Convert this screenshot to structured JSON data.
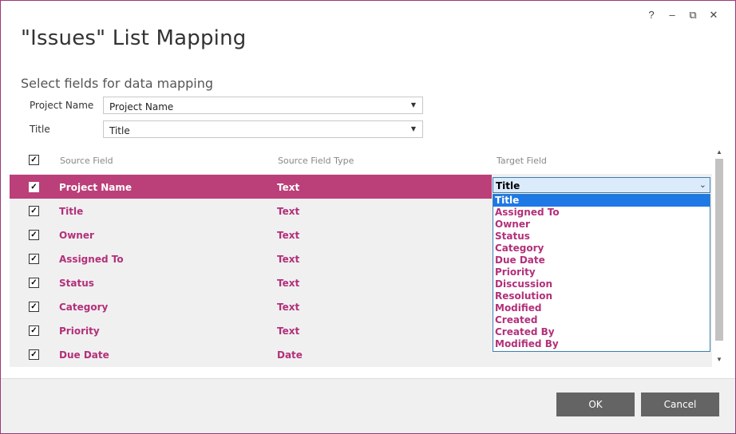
{
  "window_controls": {
    "help": "?",
    "minimize": "–",
    "restore": "⧉",
    "close": "✕"
  },
  "title": "\"Issues\" List Mapping",
  "subtitle": "Select fields for data mapping",
  "fields": [
    {
      "label": "Project Name",
      "value": "Project Name"
    },
    {
      "label": "Title",
      "value": "Title"
    }
  ],
  "grid": {
    "header": {
      "source_field": "Source Field",
      "source_field_type": "Source Field Type",
      "target_field": "Target Field",
      "all_checked": true
    },
    "rows": [
      {
        "source": "Project Name",
        "type": "Text",
        "checked": true,
        "selected": true
      },
      {
        "source": "Title",
        "type": "Text",
        "checked": true
      },
      {
        "source": "Owner",
        "type": "Text",
        "checked": true
      },
      {
        "source": "Assigned To",
        "type": "Text",
        "checked": true
      },
      {
        "source": "Status",
        "type": "Text",
        "checked": true
      },
      {
        "source": "Category",
        "type": "Text",
        "checked": true
      },
      {
        "source": "Priority",
        "type": "Text",
        "checked": true
      },
      {
        "source": "Due Date",
        "type": "Date",
        "checked": true
      }
    ]
  },
  "target_dropdown": {
    "value": "Title",
    "options": [
      "Title",
      "Assigned To",
      "Owner",
      "Status",
      "Category",
      "Due Date",
      "Priority",
      "Discussion",
      "Resolution",
      "Modified",
      "Created",
      "Created By",
      "Modified By"
    ],
    "highlighted": "Title"
  },
  "buttons": {
    "ok": "OK",
    "cancel": "Cancel"
  },
  "colors": {
    "accent": "#bb3f79",
    "text_accent": "#b2307a",
    "highlight": "#1e78e6",
    "button": "#646464"
  }
}
